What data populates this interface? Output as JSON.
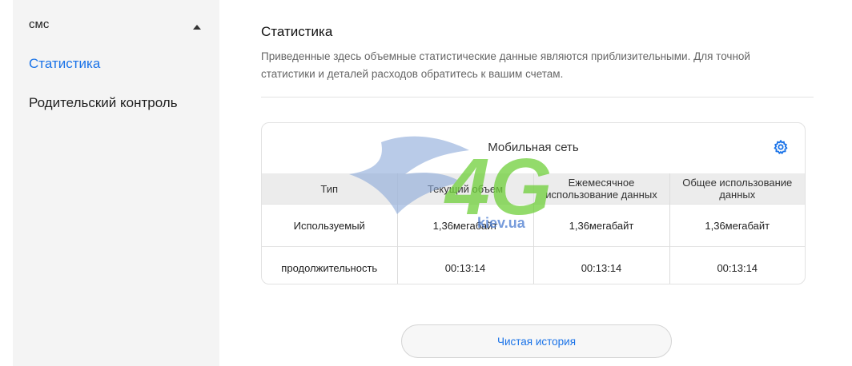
{
  "sidebar": {
    "items": [
      {
        "label": "смс"
      },
      {
        "label": "Статистика"
      },
      {
        "label": "Родительский контроль"
      }
    ]
  },
  "main": {
    "title": "Статистика",
    "description": "Приведенные здесь объемные статистические данные являются приблизительными. Для точной статистики и деталей расходов обратитесь к вашим счетам.",
    "card": {
      "title": "Мобильная сеть",
      "headers": [
        "Тип",
        "Текущий объем",
        "Ежемесячное использование данных",
        "Общее использование данных"
      ],
      "rows": [
        [
          "Используемый",
          "1,36мегабайт",
          "1,36мегабайт",
          "1,36мегабайт"
        ],
        [
          "продолжительность",
          "00:13:14",
          "00:13:14",
          "00:13:14"
        ]
      ]
    },
    "clear_button": "Чистая история"
  },
  "watermark": {
    "text": "4G",
    "site": "kiev.ua"
  },
  "colors": {
    "accent": "#1a73e8",
    "sidebar_bg": "#f4f4f4",
    "header_bg": "#ececec"
  }
}
